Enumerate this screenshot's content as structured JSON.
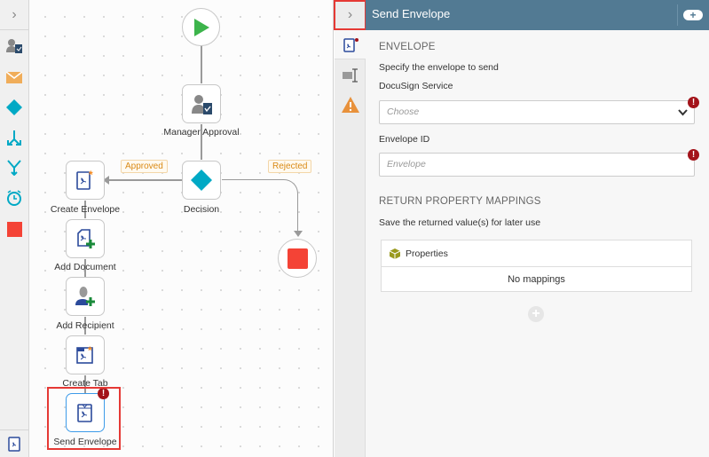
{
  "toolbar": {
    "items": [
      "user-task-icon",
      "email-icon",
      "decision-icon",
      "split-icon",
      "merge-icon",
      "timer-icon",
      "stop-icon",
      "docusign-icon"
    ]
  },
  "canvas": {
    "nodes": {
      "manager_approval": "Manager Approval",
      "decision": "Decision",
      "create_envelope": "Create Envelope",
      "add_document": "Add Document",
      "add_recipient": "Add Recipient",
      "create_tab": "Create Tab",
      "send_envelope": "Send Envelope"
    },
    "edge_labels": {
      "approved": "Approved",
      "rejected": "Rejected"
    }
  },
  "panel": {
    "title": "Send Envelope",
    "envelope_section": "ENVELOPE",
    "envelope_desc": "Specify the envelope to send",
    "docusign_label": "DocuSign Service",
    "docusign_placeholder": "Choose",
    "envelope_id_label": "Envelope ID",
    "envelope_id_placeholder": "Envelope",
    "return_section": "RETURN PROPERTY MAPPINGS",
    "return_desc": "Save the returned value(s) for later use",
    "properties_header": "Properties",
    "no_mappings": "No mappings"
  },
  "colors": {
    "header": "#527a93",
    "accent": "#00a9c5",
    "error": "#a3131a",
    "stop": "#f44336",
    "start": "#3cb44b"
  }
}
